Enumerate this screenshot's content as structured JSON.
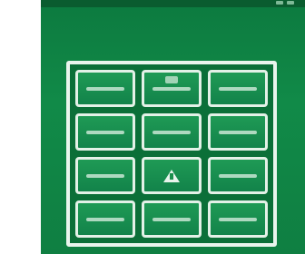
{
  "screen": {
    "background": "#ffffff",
    "accent": "#118a48"
  },
  "status_bar": {
    "icons": [
      "signal-icon",
      "battery-icon"
    ]
  },
  "grid": {
    "rows": 4,
    "columns": 3,
    "tiles": [
      {
        "icon": "label-bar-icon"
      },
      {
        "icon": "label-bar-icon"
      },
      {
        "icon": "label-bar-icon"
      },
      {
        "icon": "label-bar-icon"
      },
      {
        "icon": "label-bar-icon"
      },
      {
        "icon": "label-bar-icon"
      },
      {
        "icon": "label-bar-icon"
      },
      {
        "icon": "warning-icon"
      },
      {
        "icon": "label-bar-icon"
      },
      {
        "icon": "label-bar-icon"
      },
      {
        "icon": "label-bar-icon"
      },
      {
        "icon": "label-bar-icon"
      }
    ]
  }
}
